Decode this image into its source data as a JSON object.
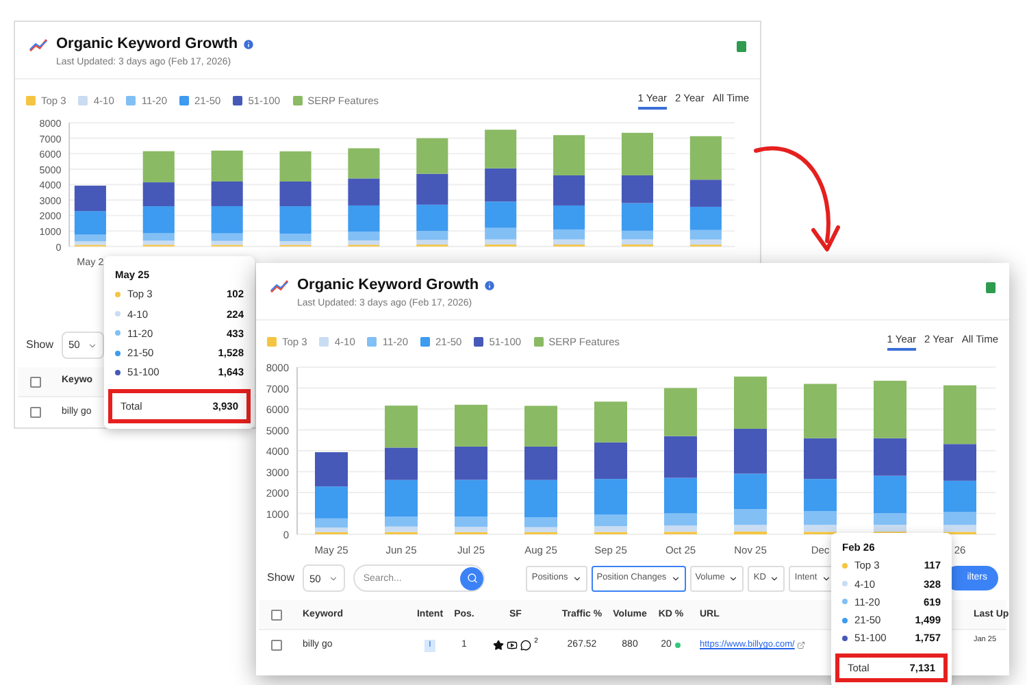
{
  "back_panel": {
    "title": "Organic Keyword Growth",
    "last_updated": "Last Updated: 3 days ago (Feb 17, 2026)",
    "range_tabs": [
      {
        "label": "1 Year",
        "selected": true
      },
      {
        "label": "2 Year",
        "selected": false
      },
      {
        "label": "All Time",
        "selected": false
      }
    ],
    "chart_data": {
      "type": "bar",
      "stacked": true,
      "grid": true,
      "categories": [
        "May 2",
        null,
        null,
        null,
        null,
        null,
        null,
        null,
        null,
        null
      ],
      "yticks": [
        0,
        1000,
        2000,
        3000,
        4000,
        5000,
        6000,
        7000,
        8000
      ],
      "ylim": [
        0,
        8000
      ],
      "series": [
        {
          "name": "Top 3",
          "color": "#f5c542",
          "values": [
            102,
            110,
            105,
            100,
            110,
            120,
            130,
            120,
            125,
            117
          ]
        },
        {
          "name": "4-10",
          "color": "#c9dcf2",
          "values": [
            224,
            260,
            250,
            240,
            280,
            300,
            320,
            330,
            330,
            328
          ]
        },
        {
          "name": "11-20",
          "color": "#82bff5",
          "values": [
            433,
            480,
            490,
            480,
            560,
            580,
            750,
            650,
            560,
            619
          ]
        },
        {
          "name": "21-50",
          "color": "#3d9bf0",
          "values": [
            1528,
            1750,
            1760,
            1780,
            1700,
            1700,
            1700,
            1550,
            1785,
            1499
          ]
        },
        {
          "name": "51-100",
          "color": "#4659b8",
          "values": [
            1643,
            1550,
            1595,
            1600,
            1750,
            2000,
            2150,
            1950,
            1800,
            1757
          ]
        },
        {
          "name": "SERP Features",
          "color": "#8aba64",
          "values": [
            0,
            2010,
            2000,
            1950,
            1950,
            2300,
            2500,
            2600,
            2750,
            2811
          ]
        }
      ]
    },
    "show_label": "Show",
    "page_size": "50",
    "columns": [
      {
        "kind": "checkbox",
        "checked": false
      },
      {
        "kind": "text",
        "label": "Keywo"
      }
    ],
    "rows": [
      [
        {
          "kind": "checkbox",
          "checked": false
        },
        {
          "kind": "text",
          "text": "billy go"
        }
      ]
    ],
    "tooltip": {
      "date": "May 25",
      "rows": [
        {
          "label": "Top 3",
          "value": "102",
          "color": "#f5c542"
        },
        {
          "label": "4-10",
          "value": "224",
          "color": "#c9dcf2"
        },
        {
          "label": "11-20",
          "value": "433",
          "color": "#82bff5"
        },
        {
          "label": "21-50",
          "value": "1,528",
          "color": "#3d9bf0"
        },
        {
          "label": "51-100",
          "value": "1,643",
          "color": "#4659b8"
        }
      ],
      "total_label": "Total",
      "total_value": "3,930"
    }
  },
  "front_panel": {
    "title": "Organic Keyword Growth",
    "last_updated": "Last Updated: 3 days ago (Feb 17, 2026)",
    "range_tabs": [
      {
        "label": "1 Year",
        "selected": true
      },
      {
        "label": "2 Year",
        "selected": false
      },
      {
        "label": "All Time",
        "selected": false
      }
    ],
    "chart_data": {
      "type": "bar",
      "stacked": true,
      "grid": true,
      "categories": [
        "May 25",
        "Jun 25",
        "Jul 25",
        "Aug 25",
        "Sep 25",
        "Oct 25",
        "Nov 25",
        "Dec",
        null,
        "26"
      ],
      "yticks": [
        0,
        1000,
        2000,
        3000,
        4000,
        5000,
        6000,
        7000,
        8000
      ],
      "ylim": [
        0,
        8000
      ],
      "series": [
        {
          "name": "Top 3",
          "color": "#f5c542",
          "values": [
            102,
            110,
            105,
            100,
            110,
            120,
            130,
            120,
            125,
            117
          ]
        },
        {
          "name": "4-10",
          "color": "#c9dcf2",
          "values": [
            224,
            260,
            250,
            240,
            280,
            300,
            320,
            330,
            330,
            328
          ]
        },
        {
          "name": "11-20",
          "color": "#82bff5",
          "values": [
            433,
            480,
            490,
            480,
            560,
            580,
            750,
            650,
            560,
            619
          ]
        },
        {
          "name": "21-50",
          "color": "#3d9bf0",
          "values": [
            1528,
            1750,
            1760,
            1780,
            1700,
            1700,
            1700,
            1550,
            1785,
            1499
          ]
        },
        {
          "name": "51-100",
          "color": "#4659b8",
          "values": [
            1643,
            1550,
            1595,
            1600,
            1750,
            2000,
            2150,
            1950,
            1800,
            1757
          ]
        },
        {
          "name": "SERP Features",
          "color": "#8aba64",
          "values": [
            0,
            2010,
            2000,
            1950,
            1950,
            2300,
            2500,
            2600,
            2750,
            2811
          ]
        }
      ]
    },
    "show_label": "Show",
    "page_size": "50",
    "search": {
      "placeholder": "Search..."
    },
    "filters": [
      {
        "label": "Positions",
        "selected": false
      },
      {
        "label": "Position Changes",
        "selected": true
      },
      {
        "label": "Volume",
        "selected": false
      },
      {
        "label": "KD",
        "selected": false
      },
      {
        "label": "Intent",
        "selected": false
      }
    ],
    "filters_button": "ilters",
    "columns": [
      {
        "kind": "checkbox",
        "checked": false
      },
      {
        "kind": "text",
        "label": "Keyword"
      },
      {
        "kind": "text",
        "label": "Intent"
      },
      {
        "kind": "text",
        "label": "Pos."
      },
      {
        "kind": "text",
        "label": "SF"
      },
      {
        "kind": "text",
        "label": "Traffic %"
      },
      {
        "kind": "text",
        "label": "Volume"
      },
      {
        "kind": "text",
        "label": "KD %"
      },
      {
        "kind": "text",
        "label": "URL"
      },
      {
        "kind": "text",
        "label": "Last Up"
      }
    ],
    "rows": [
      [
        {
          "kind": "checkbox",
          "checked": false
        },
        {
          "kind": "text",
          "text": "billy go"
        },
        {
          "kind": "badge",
          "text": "I"
        },
        {
          "kind": "text",
          "text": "1"
        },
        {
          "kind": "icons",
          "text": "2"
        },
        {
          "kind": "text",
          "text": "267.52"
        },
        {
          "kind": "text",
          "text": "880"
        },
        {
          "kind": "kd",
          "text": "20",
          "color": "#34c77b"
        },
        {
          "kind": "link",
          "text": "https://www.billygo.com/"
        },
        {
          "kind": "date",
          "text": "Jan 25"
        }
      ]
    ],
    "tooltip": {
      "date": "Feb 26",
      "rows": [
        {
          "label": "Top 3",
          "value": "117",
          "color": "#f5c542"
        },
        {
          "label": "4-10",
          "value": "328",
          "color": "#c9dcf2"
        },
        {
          "label": "11-20",
          "value": "619",
          "color": "#82bff5"
        },
        {
          "label": "21-50",
          "value": "1,499",
          "color": "#3d9bf0"
        },
        {
          "label": "51-100",
          "value": "1,757",
          "color": "#4659b8"
        }
      ],
      "total_label": "Total",
      "total_value": "7,131"
    }
  }
}
